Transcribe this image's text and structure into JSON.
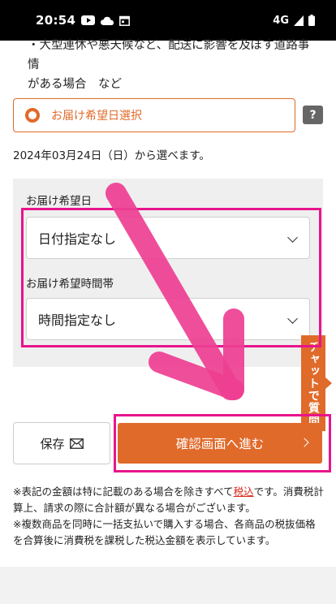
{
  "status_bar": {
    "time": "20:54",
    "network": "4G"
  },
  "warning_text": {
    "line1": "・大型連休や悪天候など、配送に影響を及ぼす道路事情",
    "line2": "がある場合　など"
  },
  "delivery_option": {
    "label": "お届け希望日選択",
    "help": "?"
  },
  "date_note": "2024年03月24日（日）から選べます。",
  "date_field": {
    "label": "お届け希望日",
    "value": "日付指定なし"
  },
  "time_field": {
    "label": "お届け希望時間帯",
    "value": "時間指定なし"
  },
  "chat_tab": "チャットで質問",
  "save_button": "保存",
  "confirm_button": "確認画面へ進む",
  "notes": {
    "p1_a": "※表記の金額は特に記載のある場合を除きすべて",
    "p1_link": "税込",
    "p1_b": "です。消費税計算上、請求の際に合計額が異なる場合がございます。",
    "p2": "※複数商品を同時に一括支払いで購入する場合、各商品の税抜価格を合算後に消費税を課税した税込金額を表示しています。"
  },
  "colors": {
    "accent": "#e06a2a",
    "highlight": "#e8148c",
    "arrow": "#ee3f93"
  }
}
